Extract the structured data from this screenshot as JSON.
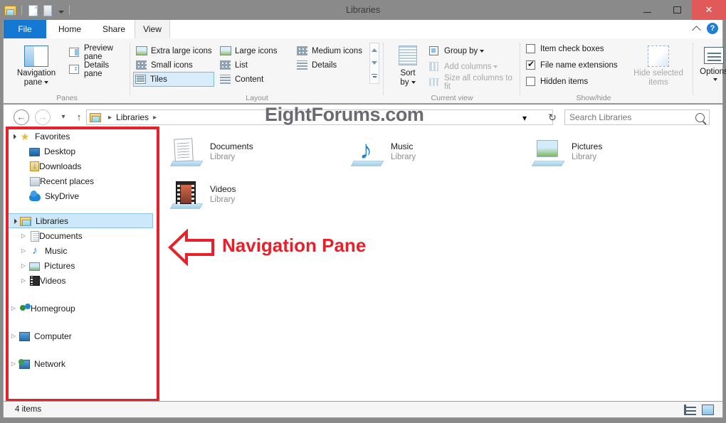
{
  "window": {
    "title": "Libraries",
    "minimize_label": "Minimize",
    "maximize_label": "Maximize",
    "close_label": "✕"
  },
  "quick_access": {
    "items": [
      {
        "name": "folder-properties-icon",
        "label": "Properties"
      },
      {
        "name": "new-folder-icon",
        "label": "New folder"
      },
      {
        "name": "customize-icon",
        "label": "Customize Quick Access Toolbar"
      }
    ]
  },
  "tabs": [
    {
      "id": "file",
      "label": "File",
      "active": false
    },
    {
      "id": "home",
      "label": "Home",
      "active": false
    },
    {
      "id": "share",
      "label": "Share",
      "active": false
    },
    {
      "id": "view",
      "label": "View",
      "active": true
    }
  ],
  "ribbon_right": {
    "collapse_label": "Minimize the Ribbon",
    "help_label": "?"
  },
  "ribbon": {
    "groups": [
      {
        "id": "panes",
        "label": "Panes",
        "big_button": {
          "label_line1": "Navigation",
          "label_line2": "pane"
        },
        "buttons": [
          {
            "label": "Preview pane",
            "enabled": true
          },
          {
            "label": "Details pane",
            "enabled": true
          }
        ]
      },
      {
        "id": "layout",
        "label": "Layout",
        "items": [
          {
            "label": "Extra large icons",
            "selected": false
          },
          {
            "label": "Large icons",
            "selected": false
          },
          {
            "label": "Medium icons",
            "selected": false
          },
          {
            "label": "Small icons",
            "selected": false
          },
          {
            "label": "List",
            "selected": false
          },
          {
            "label": "Details",
            "selected": false
          },
          {
            "label": "Tiles",
            "selected": true
          },
          {
            "label": "Content",
            "selected": false
          }
        ]
      },
      {
        "id": "current-view",
        "label": "Current view",
        "sort_by": {
          "line1": "Sort",
          "line2": "by"
        },
        "buttons": [
          {
            "label": "Group by",
            "enabled": true,
            "dropdown": true
          },
          {
            "label": "Add columns",
            "enabled": false,
            "dropdown": true
          },
          {
            "label": "Size all columns to fit",
            "enabled": false,
            "dropdown": false
          }
        ]
      },
      {
        "id": "show-hide",
        "label": "Show/hide",
        "checkboxes": [
          {
            "label": "Item check boxes",
            "checked": false
          },
          {
            "label": "File name extensions",
            "checked": true
          },
          {
            "label": "Hidden items",
            "checked": false
          }
        ],
        "hide_selected": {
          "line1": "Hide selected",
          "line2": "items",
          "enabled": false
        },
        "options": {
          "label": "Options"
        }
      }
    ]
  },
  "addressbar": {
    "back_label": "←",
    "forward_label": "→",
    "recent_label": "▾",
    "up_label": "↑",
    "breadcrumb": [
      "Libraries"
    ],
    "breadcrumb_sep": "▸",
    "dropdown_label": "▾",
    "refresh_label": "↻",
    "search_placeholder": "Search Libraries"
  },
  "watermark": {
    "text": "EightForums.com"
  },
  "navigation_pane": {
    "items": [
      {
        "label": "Favorites",
        "icon": "star-icon",
        "indent": 0,
        "expander": "open",
        "selected": false
      },
      {
        "label": "Desktop",
        "icon": "desktop-icon",
        "indent": 1,
        "expander": "none",
        "selected": false
      },
      {
        "label": "Downloads",
        "icon": "downloads-icon",
        "indent": 1,
        "expander": "none",
        "selected": false
      },
      {
        "label": "Recent places",
        "icon": "recent-icon",
        "indent": 1,
        "expander": "none",
        "selected": false
      },
      {
        "label": "SkyDrive",
        "icon": "skydrive-icon",
        "indent": 1,
        "expander": "none",
        "selected": false
      },
      {
        "label": "Libraries",
        "icon": "library-icon",
        "indent": 0,
        "expander": "open",
        "selected": true
      },
      {
        "label": "Documents",
        "icon": "documents-icon",
        "indent": 1,
        "expander": "closed",
        "selected": false
      },
      {
        "label": "Music",
        "icon": "music-icon",
        "indent": 1,
        "expander": "closed",
        "selected": false
      },
      {
        "label": "Pictures",
        "icon": "pictures-icon",
        "indent": 1,
        "expander": "closed",
        "selected": false
      },
      {
        "label": "Videos",
        "icon": "videos-icon",
        "indent": 1,
        "expander": "closed",
        "selected": false
      },
      {
        "label": "Homegroup",
        "icon": "homegroup-icon",
        "indent": 0,
        "expander": "closed",
        "selected": false
      },
      {
        "label": "Computer",
        "icon": "computer-icon",
        "indent": 0,
        "expander": "closed",
        "selected": false
      },
      {
        "label": "Network",
        "icon": "network-icon",
        "indent": 0,
        "expander": "closed",
        "selected": false
      }
    ]
  },
  "content": {
    "tiles": [
      {
        "name": "Documents",
        "subtitle": "Library",
        "icon": "documents-library-icon"
      },
      {
        "name": "Music",
        "subtitle": "Library",
        "icon": "music-library-icon"
      },
      {
        "name": "Pictures",
        "subtitle": "Library",
        "icon": "pictures-library-icon"
      },
      {
        "name": "Videos",
        "subtitle": "Library",
        "icon": "videos-library-icon"
      }
    ]
  },
  "annotation": {
    "text": "Navigation Pane",
    "color": "#e8202a"
  },
  "statusbar": {
    "item_count": "4 items",
    "view_details_label": "Details view",
    "view_tiles_label": "Large icons view"
  },
  "colors": {
    "accent_blue": "#1578d3",
    "annotation_red": "#e8202a",
    "selection_blue": "#cde8f9",
    "titlebar_gray": "#8a8a8a"
  }
}
